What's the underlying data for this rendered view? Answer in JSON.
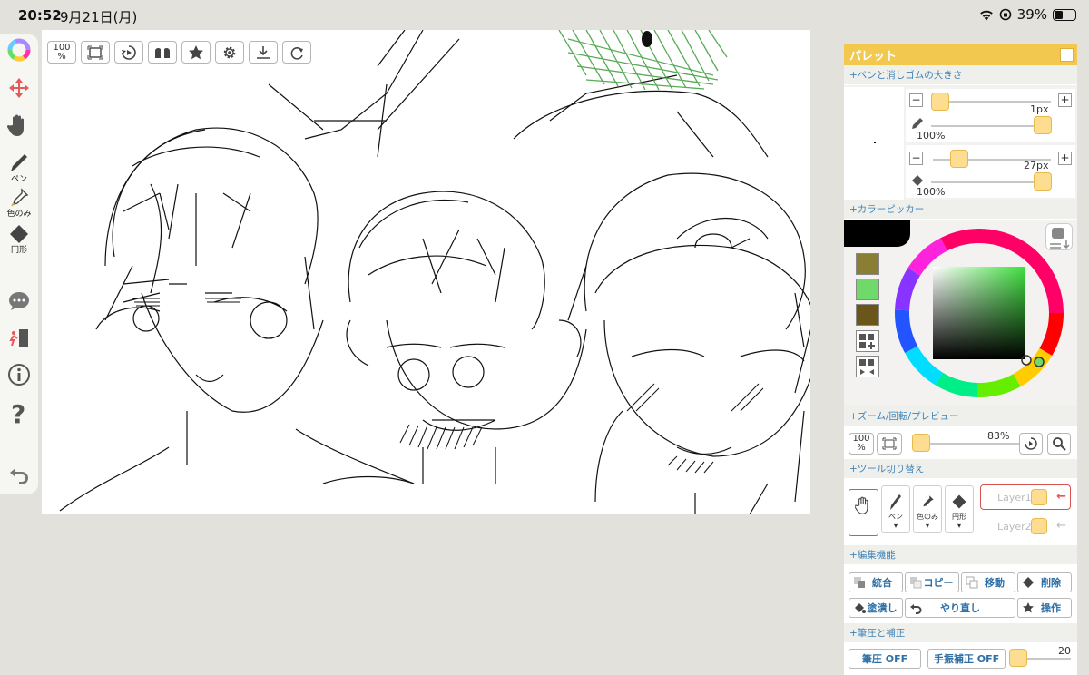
{
  "status": {
    "time": "20:52",
    "date": "9月21日(月)",
    "battery": "39%",
    "battery_level": 0.39
  },
  "left_toolbar": {
    "tools": [
      {
        "name": "color-wheel",
        "label": ""
      },
      {
        "name": "move",
        "label": ""
      },
      {
        "name": "hand",
        "label": ""
      },
      {
        "name": "pen",
        "label": "ペン"
      },
      {
        "name": "eyedropper",
        "label": "色のみ"
      },
      {
        "name": "shape",
        "label": "円形"
      }
    ]
  },
  "canvas_toolbar": {
    "zoom": "100",
    "zoom_unit": "%"
  },
  "palette": {
    "title": "パレット",
    "sections": {
      "pen_size": "+ペンと消しゴムの大きさ",
      "color_picker": "+カラーピッカー",
      "zoom": "+ズーム/回転/プレビュー",
      "tool_switch": "+ツール切り替え",
      "edit": "+編集機能",
      "pressure": "+筆圧と補正"
    },
    "pen": {
      "size": "1px",
      "opacity": "100%"
    },
    "eraser": {
      "size": "27px",
      "opacity": "100%"
    },
    "colors": {
      "current": "#000000",
      "swatches": [
        "#8a7d34",
        "#6fd96a",
        "#6a561a"
      ]
    },
    "zoom": {
      "value": "83%",
      "btn": "100",
      "unit": "%"
    },
    "tools": {
      "pen": "ペン",
      "eyedropper": "色のみ",
      "shape": "円形"
    },
    "layers": [
      "Layer1",
      "Layer2"
    ],
    "edit_buttons": [
      "統合",
      "コピー",
      "移動",
      "削除",
      "塗潰し",
      "やり直し",
      "操作"
    ],
    "pressure": {
      "pressure_btn": "筆圧 OFF",
      "stabilizer_btn": "手振補正 OFF",
      "value": "20"
    }
  },
  "accent": "#f2c84e",
  "link_color": "#3d83b8"
}
